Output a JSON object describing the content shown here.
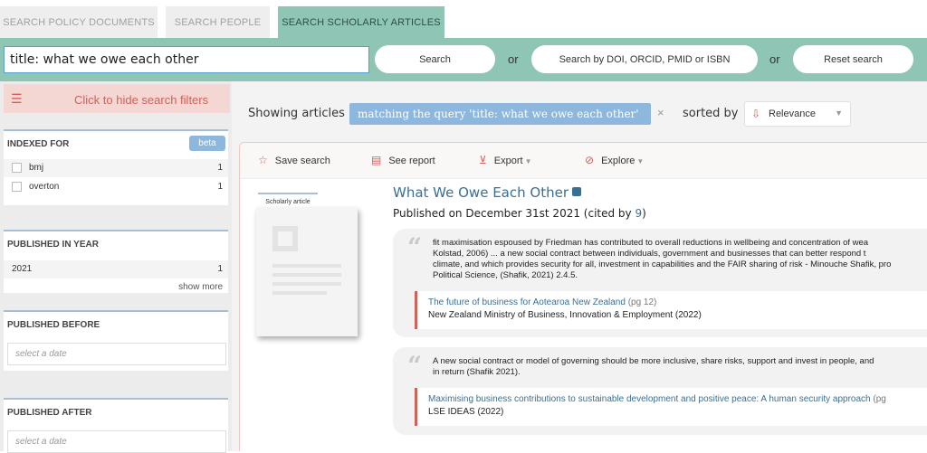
{
  "tabs": [
    {
      "label": "SEARCH POLICY DOCUMENTS"
    },
    {
      "label": "SEARCH PEOPLE"
    },
    {
      "label": "SEARCH SCHOLARLY ARTICLES"
    }
  ],
  "search": {
    "value": "title: what we owe each other",
    "search_button": "Search",
    "or1": "or",
    "doi_button": "Search by DOI, ORCID, PMID or ISBN",
    "or2": "or",
    "reset_button": "Reset search"
  },
  "sidebar": {
    "hide_filters": "Click to hide search filters",
    "indexed_for": {
      "title": "INDEXED FOR",
      "badge": "beta",
      "items": [
        {
          "label": "bmj",
          "count": "1"
        },
        {
          "label": "overton",
          "count": "1"
        }
      ]
    },
    "published_in_year": {
      "title": "PUBLISHED IN YEAR",
      "items": [
        {
          "label": "2021",
          "count": "1"
        }
      ],
      "show_more": "show more"
    },
    "published_before": {
      "title": "PUBLISHED BEFORE",
      "placeholder": "select a date"
    },
    "published_after": {
      "title": "PUBLISHED AFTER",
      "placeholder": "select a date"
    }
  },
  "results_bar": {
    "showing": "Showing articles",
    "query_chip": "matching the query 'title: what we owe each other'",
    "remove": "×",
    "sorted_by": "sorted by",
    "sort_value": "Relevance"
  },
  "toolbar": {
    "save": "Save search",
    "report": "See report",
    "export": "Export",
    "explore": "Explore"
  },
  "article": {
    "type_label": "Scholarly article",
    "title": "What We Owe Each Other",
    "published_prefix": "Published on December 31st 2021 (cited by ",
    "cited_count": "9",
    "published_suffix": ")",
    "quotes": [
      {
        "lines": [
          "fit maximisation espoused by Friedman has contributed to overall reductions in wellbeing and concentration of wea",
          "Kolstad, 2006) ... a new social contract between individuals, government and businesses that can better respond t",
          "climate, and which provides security for all, investment in capabilities and the FAIR sharing of risk - Minouche Shafik, pro",
          "Political Science, (Shafik, 2021) 2.4.5."
        ],
        "source_title": "The future of business for Aotearoa New Zealand",
        "source_page": "(pg 12)",
        "source_org": "New Zealand Ministry of Business, Innovation & Employment (2022)"
      },
      {
        "lines": [
          "A new social contract or model of governing should be more inclusive, share risks, support and invest in people, and",
          "in return (Shafik 2021)."
        ],
        "source_title": "Maximising business contributions to sustainable development and positive peace: A human security approach",
        "source_page": "(pg",
        "source_org": "LSE IDEAS (2022)"
      }
    ]
  },
  "colors": {
    "teal": "#8fc5b5",
    "coral": "#d2605a",
    "blue_link": "#3a6f95",
    "chip_blue": "#8db7dc"
  }
}
